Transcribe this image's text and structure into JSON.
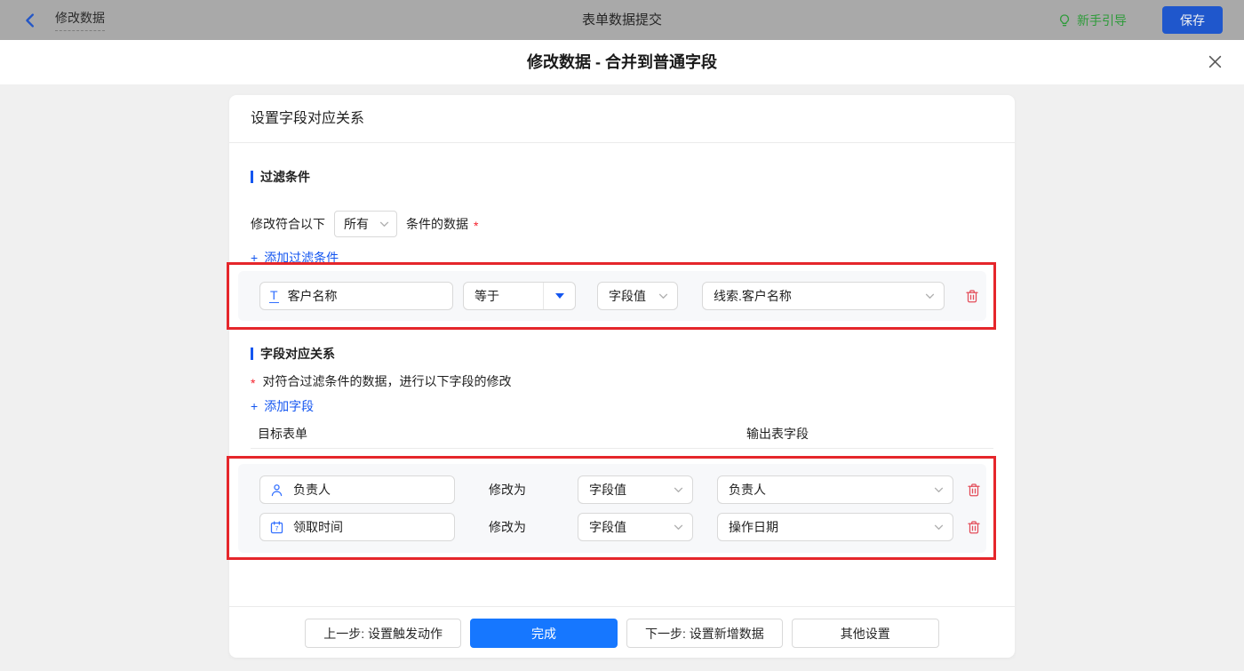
{
  "topbar": {
    "back": "修改数据",
    "center_title": "表单数据提交",
    "guide": "新手引导",
    "save": "保存"
  },
  "modal": {
    "title": "修改数据 - 合并到普通字段"
  },
  "panel": {
    "header": "设置字段对应关系",
    "filter": {
      "title": "过滤条件",
      "prefix": "修改符合以下",
      "match_value": "所有",
      "suffix": "条件的数据",
      "required": "*",
      "add_plus": "+",
      "add_label": "添加过滤条件",
      "row": {
        "field": "客户名称",
        "operator": "等于",
        "value_type": "字段值",
        "value": "线索.客户名称"
      }
    },
    "mapping": {
      "title": "字段对应关系",
      "required": "*",
      "desc": "对符合过滤条件的数据，进行以下字段的修改",
      "add_plus": "+",
      "add_label": "添加字段",
      "col_left": "目标表单",
      "col_right": "输出表字段",
      "rows": [
        {
          "field": "负责人",
          "action": "修改为",
          "value_type": "字段值",
          "value": "负责人"
        },
        {
          "field": "领取时间",
          "action": "修改为",
          "value_type": "字段值",
          "value": "操作日期"
        }
      ]
    },
    "footer": {
      "prev": "上一步: 设置触发动作",
      "done": "完成",
      "next": "下一步: 设置新增数据",
      "other": "其他设置"
    }
  },
  "icons": {
    "text_field_glyph": "T",
    "calendar_day": "7"
  },
  "colors": {
    "accent_blue": "#1677FF",
    "link_blue": "#1456F0",
    "field_icon_blue": "#3370FF",
    "annotation_red": "#E5262B",
    "trash_red": "#E34D59",
    "guide_green": "#2E9B3A",
    "save_button_blue": "#1F57CC",
    "topbar_gray": "#A9A9A9",
    "body_gray": "#F0F0F0"
  }
}
